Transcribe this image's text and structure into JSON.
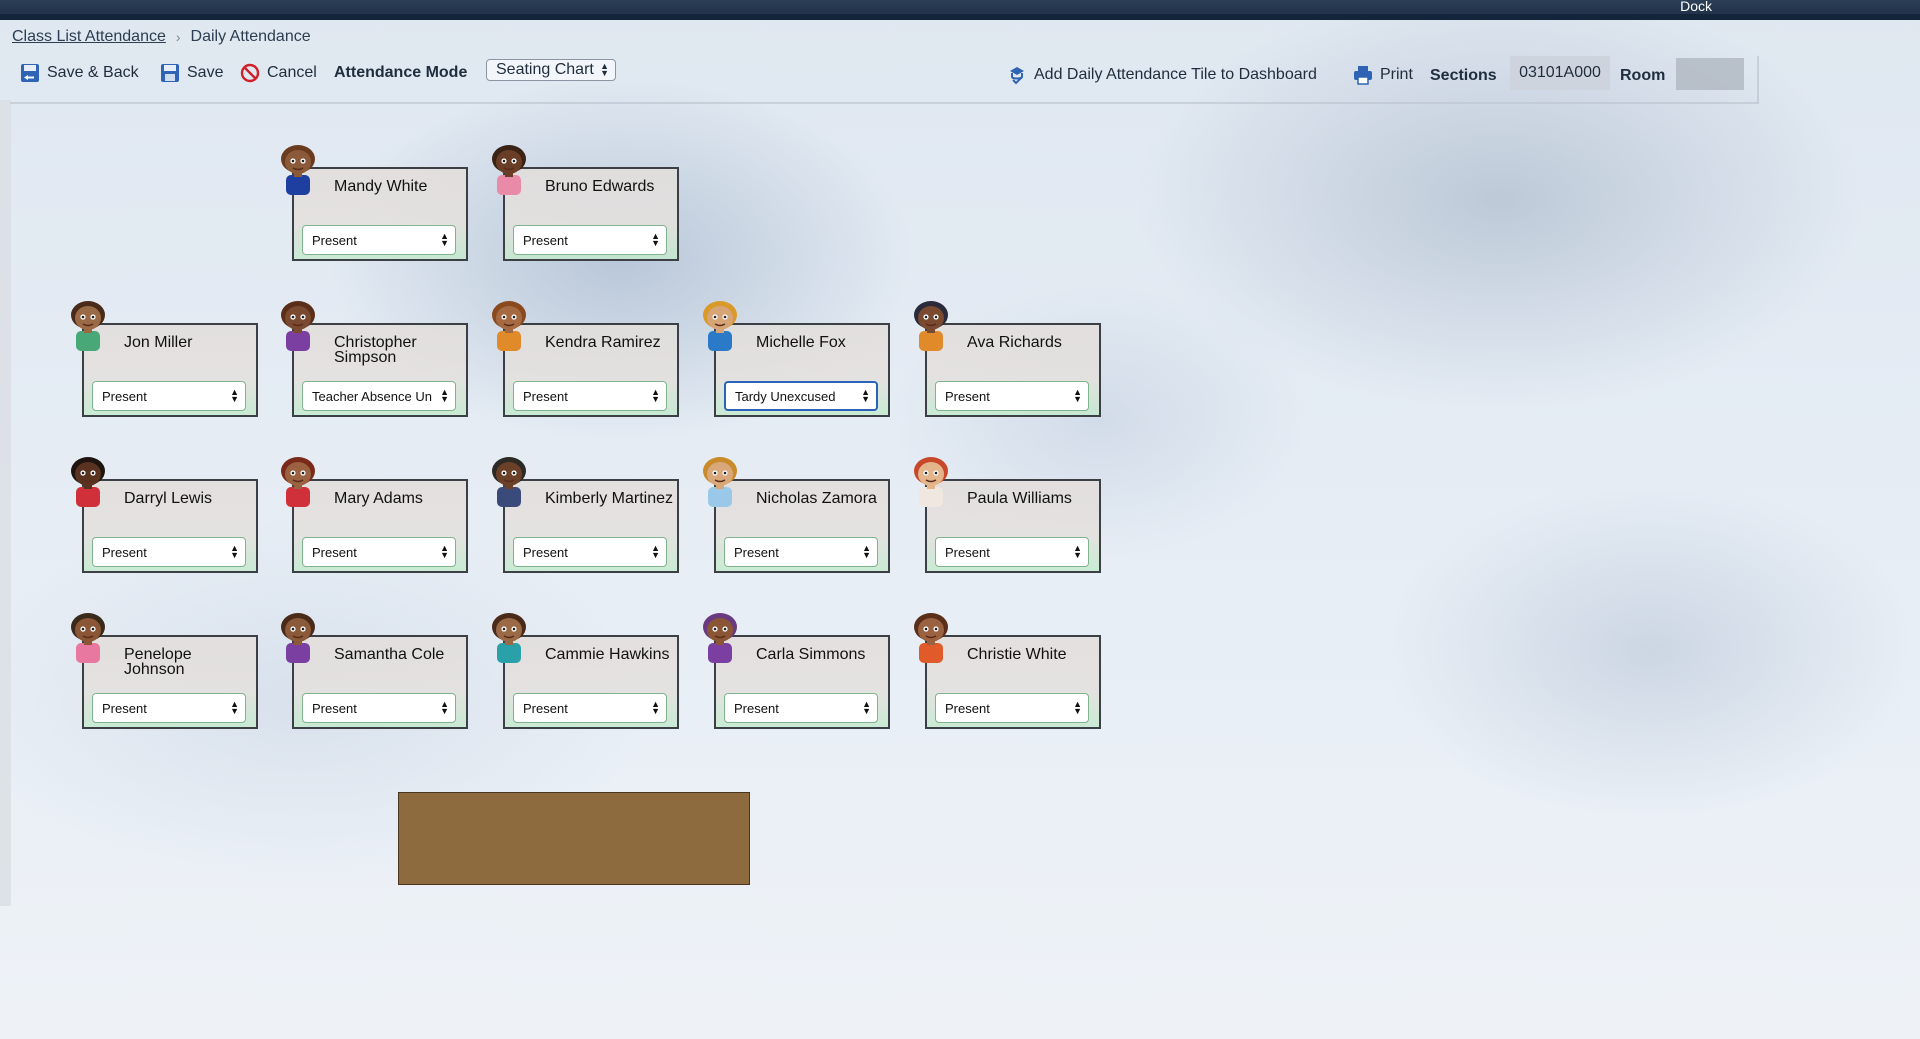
{
  "window": {
    "dock_label": "Dock"
  },
  "breadcrumb": {
    "parent": "Class List Attendance",
    "current": "Daily Attendance"
  },
  "toolbar": {
    "save_back": "Save & Back",
    "save": "Save",
    "cancel": "Cancel",
    "mode_label": "Attendance Mode",
    "mode_value": "Seating Chart",
    "add_tile": "Add Daily Attendance Tile to Dashboard",
    "print": "Print",
    "sections_label": "Sections",
    "sections_value": "03101A000",
    "room_label": "Room"
  },
  "students": [
    {
      "name": "Mandy White",
      "status": "Present"
    },
    {
      "name": "Bruno Edwards",
      "status": "Present"
    },
    {
      "name": "Jon Miller",
      "status": "Present"
    },
    {
      "name": "Christopher Simpson",
      "status": "Teacher Absence Un"
    },
    {
      "name": "Kendra Ramirez",
      "status": "Present"
    },
    {
      "name": "Michelle Fox",
      "status": "Tardy Unexcused"
    },
    {
      "name": "Ava Richards",
      "status": "Present"
    },
    {
      "name": "Darryl Lewis",
      "status": "Present"
    },
    {
      "name": "Mary Adams",
      "status": "Present"
    },
    {
      "name": "Kimberly Martinez",
      "status": "Present"
    },
    {
      "name": "Nicholas Zamora",
      "status": "Present"
    },
    {
      "name": "Paula Williams",
      "status": "Present"
    },
    {
      "name": "Penelope Johnson",
      "status": "Present"
    },
    {
      "name": "Samantha Cole",
      "status": "Present"
    },
    {
      "name": "Cammie Hawkins",
      "status": "Present"
    },
    {
      "name": "Carla Simmons",
      "status": "Present"
    },
    {
      "name": "Christie White",
      "status": "Present"
    }
  ],
  "colors": {
    "hair": [
      "#6b3b1f",
      "#3a2214",
      "#4a2a18",
      "#5a2e1a",
      "#8a4a1e",
      "#d99a2a",
      "#2a2a3a",
      "#1f1410",
      "#7a2a1a",
      "#2d2a26",
      "#c98a2a",
      "#c8482a",
      "#3a2a1c",
      "#4a2a18",
      "#4a2a18",
      "#6a3a80",
      "#5a2e18"
    ],
    "shirt": [
      "#1f3fa0",
      "#e88aa8",
      "#48a878",
      "#7a3fa0",
      "#e08a2a",
      "#2a7ac8",
      "#e08a2a",
      "#d0303a",
      "#d0303a",
      "#3a4a7a",
      "#9ac8e8",
      "#f0e8e0",
      "#e878a0",
      "#7a3fa0",
      "#2aa0a8",
      "#7a3fa0",
      "#e05a2a"
    ]
  }
}
